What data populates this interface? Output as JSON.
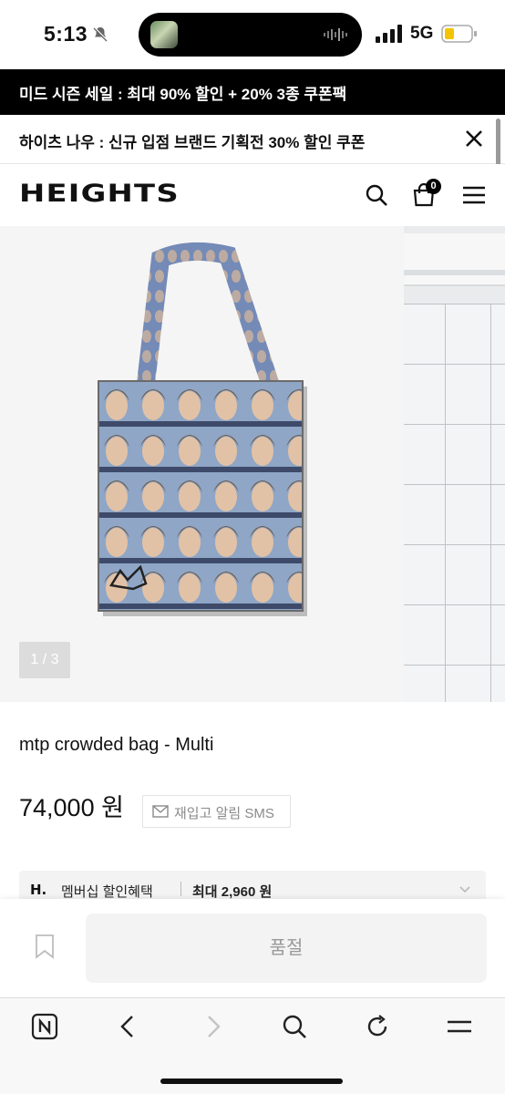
{
  "status_bar": {
    "time": "5:13",
    "network": "5G"
  },
  "banners": {
    "sale": "미드 시즌 세일 : 최대 90% 할인 + 20% 3종 쿠폰팩",
    "promo": "하이츠 나우 : 신규 입점 브랜드 기획전 30% 할인 쿠폰"
  },
  "header": {
    "logo": "HEIGHTS",
    "cart_count": "0"
  },
  "gallery": {
    "counter": "1 / 3"
  },
  "product": {
    "name": "mtp crowded bag - Multi",
    "price": "74,000 원",
    "restock_label": "재입고 알림 SMS"
  },
  "benefit": {
    "logo": "H.",
    "label": "멤버십 할인혜택",
    "value": "최대 2,960 원"
  },
  "purchase": {
    "soldout_label": "품절"
  },
  "colors": {
    "banner_bg": "#000000",
    "accent": "#111111",
    "soldout_bg": "#f3f3f3"
  }
}
